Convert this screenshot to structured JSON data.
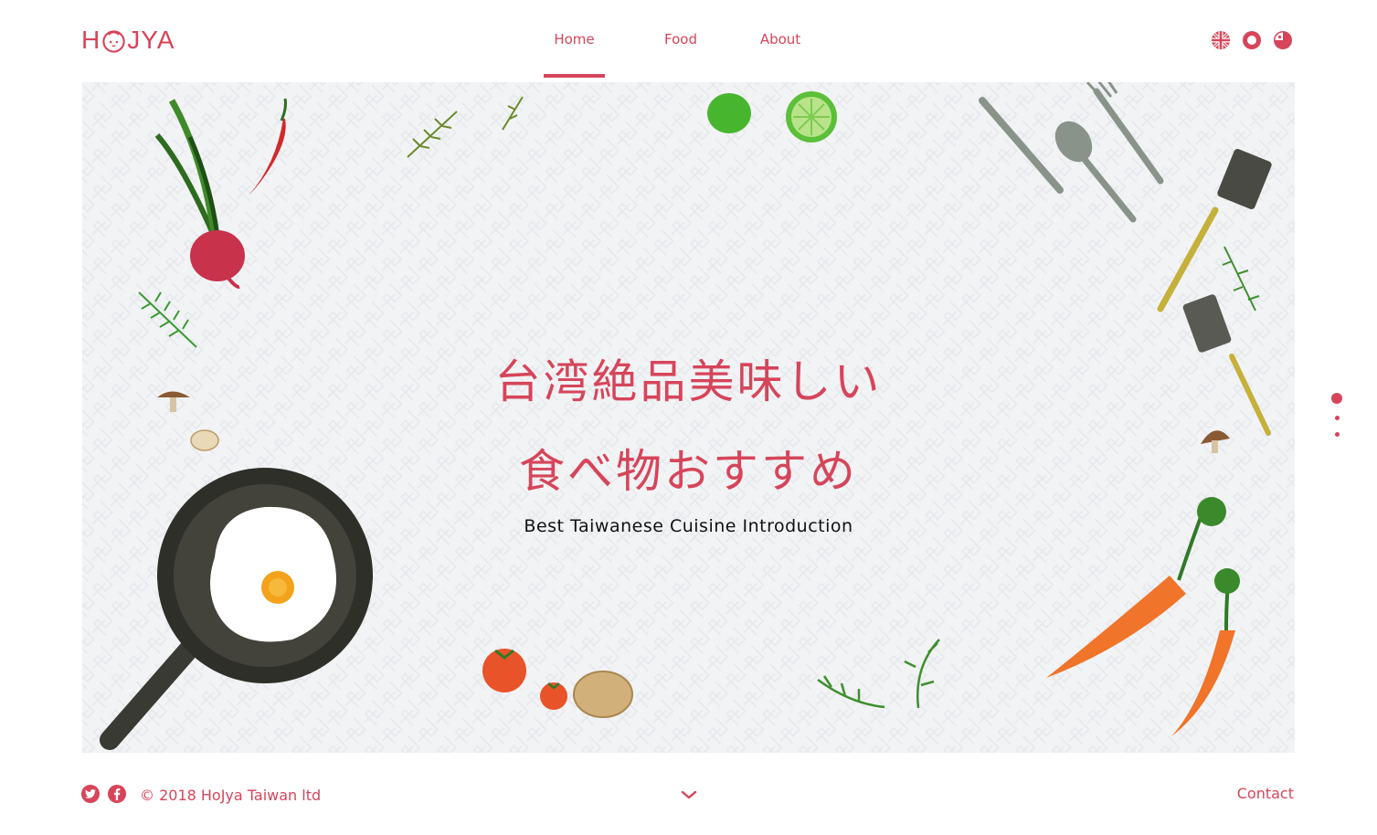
{
  "brand": {
    "logo_left": "H",
    "logo_right": "JYA",
    "accent_color": "#d6455a"
  },
  "nav": {
    "items": [
      {
        "label": "Home",
        "active": true
      },
      {
        "label": "Food",
        "active": false
      },
      {
        "label": "About",
        "active": false
      }
    ]
  },
  "header_icons": [
    "language-flag-icon",
    "record-icon",
    "pie-chart-icon"
  ],
  "hero": {
    "title_line1": "台湾絶品美味しい",
    "title_line2": "食べ物おすすめ",
    "subtitle": "Best Taiwanese Cuisine Introduction"
  },
  "pager": {
    "count": 3,
    "active_index": 0
  },
  "footer": {
    "social_icons": [
      "twitter-icon",
      "facebook-icon"
    ],
    "copyright": "© 2018 HoJya Taiwan ltd",
    "scroll_icon": "chevron-down-icon",
    "contact_label": "Contact"
  }
}
